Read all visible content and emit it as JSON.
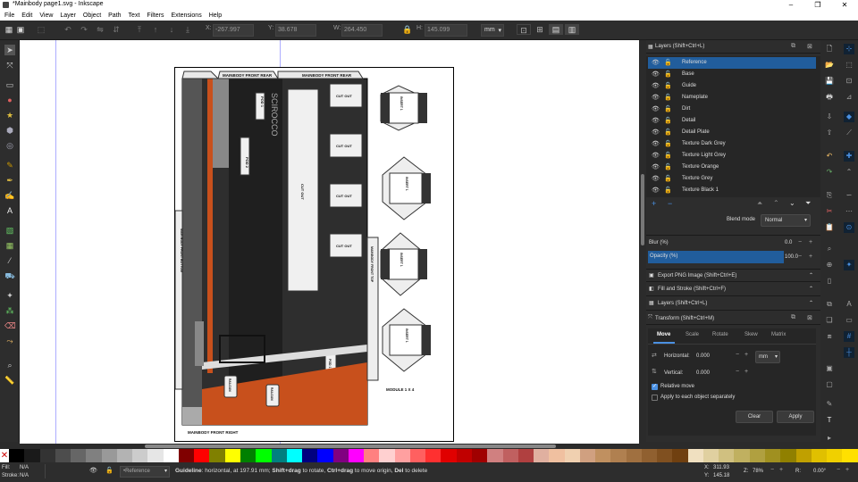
{
  "window": {
    "title": "*Mainbody page1.svg - Inkscape"
  },
  "menu": [
    "File",
    "Edit",
    "View",
    "Layer",
    "Object",
    "Path",
    "Text",
    "Filters",
    "Extensions",
    "Help"
  ],
  "controls": {
    "x_label": "X:",
    "x_value": "-267.997",
    "y_label": "Y:",
    "y_value": "38.678",
    "w_label": "W:",
    "w_value": "264.450",
    "h_label": "H:",
    "h_value": "145.099",
    "unit": "mm"
  },
  "layers_panel": {
    "title": "Layers (Shift+Ctrl+L)",
    "items": [
      "Reference",
      "Base",
      "Guide",
      "Nameplate",
      "Dirt",
      "Detail",
      "Detail Plate",
      "Texture Dark Grey",
      "Texture Light Grey",
      "Texture Orange",
      "Texture Grey",
      "Texture Black 1"
    ],
    "selected_index": 0,
    "blend_label": "Blend mode",
    "blend_value": "Normal",
    "blur_label": "Blur (%)",
    "blur_value": "0.0",
    "opacity_label": "Opacity (%)",
    "opacity_value": "100.0"
  },
  "collapsed_panels": [
    "Export PNG Image (Shift+Ctrl+E)",
    "Fill and Stroke (Shift+Ctrl+F)",
    "Layers (Shift+Ctrl+L)"
  ],
  "transform_panel": {
    "title": "Transform (Shift+Ctrl+M)",
    "tabs": [
      "Move",
      "Scale",
      "Rotate",
      "Skew",
      "Matrix"
    ],
    "active_tab": 0,
    "horizontal_label": "Horizontal:",
    "horizontal_value": "0.000",
    "vertical_label": "Vertical:",
    "vertical_value": "0.000",
    "unit": "mm",
    "relative_move_label": "Relative move",
    "relative_move_checked": true,
    "apply_each_label": "Apply to each object separately",
    "apply_each_checked": false,
    "clear_label": "Clear",
    "apply_label": "Apply"
  },
  "document": {
    "labels": {
      "front_rear_1": "MAINBODY FRONT REAR",
      "front_rear_2": "MAINBODY FRONT REAR",
      "pod1": "POD 1",
      "pod2": "POD 2",
      "scirocco": "SCIROCCO",
      "cutout": "CUT OUT",
      "cutout_big": "CUT OUT",
      "front_top": "MAINBODY FRONT TOP",
      "front_bottom": "MAIN BODY FRONT BOTTOM",
      "pod3": "POD 1",
      "railgun1": "RAILGUN",
      "railgun2": "RAILGUN",
      "front_right": "MAINBODY FRONT RIGHT",
      "module": "MODULE 1 X 4",
      "insert1": "INSERT 1"
    }
  },
  "status": {
    "fill_label": "Fill:",
    "fill_value": "N/A",
    "stroke_label": "Stroke:",
    "stroke_value": "N/A",
    "layer_value": "•Reference",
    "message_bold": "Guideline",
    "message": ": horizontal, at 197.91 mm; ",
    "message_b2": "Shift+drag",
    "message2": " to rotate, ",
    "message_b3": "Ctrl+drag",
    "message3": " to move origin, ",
    "message_b4": "Del",
    "message4": " to delete",
    "x_label": "X:",
    "x_value": "311.93",
    "y_label": "Y:",
    "y_value": "145.18",
    "zoom_label": "Z:",
    "zoom_value": "78%",
    "rotate_label": "R:",
    "rotate_value": "0.00°"
  },
  "palette": [
    "#000000",
    "#1a1a1a",
    "#333333",
    "#4d4d4d",
    "#666666",
    "#808080",
    "#999999",
    "#b3b3b3",
    "#cccccc",
    "#e6e6e6",
    "#ffffff",
    "#800000",
    "#ff0000",
    "#808000",
    "#ffff00",
    "#008000",
    "#00ff00",
    "#008080",
    "#00ffff",
    "#000080",
    "#0000ff",
    "#800080",
    "#ff00ff",
    "#ff8080",
    "#ffd0d0",
    "#ffa0a0",
    "#ff6060",
    "#ff3030",
    "#e00000",
    "#c00000",
    "#a00000",
    "#d08080",
    "#c06060",
    "#b04040",
    "#e0b0a0",
    "#f0c0a0",
    "#f0d0b0",
    "#d0a080",
    "#c09060",
    "#b08050",
    "#a07040",
    "#906030",
    "#805020",
    "#704010",
    "#f0e0c0",
    "#e0d0a0",
    "#d0c080",
    "#c0b060",
    "#b0a040",
    "#a09020",
    "#908000",
    "#c0a000",
    "#e0c000",
    "#f0d000",
    "#ffe000"
  ]
}
